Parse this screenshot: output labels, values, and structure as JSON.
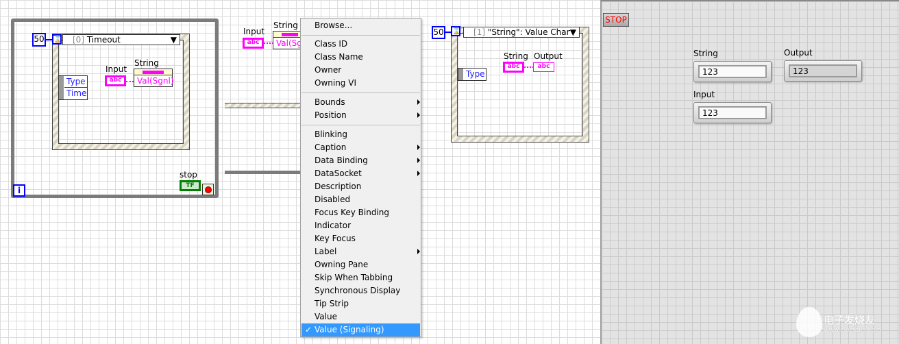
{
  "block_diagram": {
    "loop": {
      "iteration_terminal": "i",
      "stop_label": "stop",
      "stop_terminal": "TF"
    },
    "event_structure_0": {
      "timeout_value": "50",
      "selector": "Timeout",
      "selector_index": "[0]",
      "event_data": [
        "Type",
        "Time"
      ],
      "input_label": "Input",
      "input_terminal": "abc",
      "property_node_label": "String",
      "property": "Val(Sgnl)"
    },
    "partial_node": {
      "input_label": "Input",
      "input_terminal": "abc",
      "property_node_label": "String",
      "property": "Val(Sg"
    },
    "event_structure_1": {
      "timeout_value": "50",
      "selector": "\"String\": Value Chang",
      "selector_index": "[1]",
      "event_data": [
        "Type"
      ],
      "string_label": "String",
      "output_label": "Output",
      "terminal": "abc"
    }
  },
  "context_menu": {
    "groups": [
      [
        "Browse..."
      ],
      [
        "Class ID",
        "Class Name",
        "Owner",
        "Owning VI"
      ],
      [
        {
          "label": "Bounds",
          "submenu": true
        },
        {
          "label": "Position",
          "submenu": true
        }
      ],
      [
        {
          "label": "Blinking"
        },
        {
          "label": "Caption",
          "submenu": true
        },
        {
          "label": "Data Binding",
          "submenu": true
        },
        {
          "label": "DataSocket",
          "submenu": true
        },
        {
          "label": "Description"
        },
        {
          "label": "Disabled"
        },
        {
          "label": "Focus Key Binding"
        },
        {
          "label": "Indicator"
        },
        {
          "label": "Key Focus"
        },
        {
          "label": "Label",
          "submenu": true
        },
        {
          "label": "Owning Pane"
        },
        {
          "label": "Skip When Tabbing"
        },
        {
          "label": "Synchronous Display"
        },
        {
          "label": "Tip Strip"
        },
        {
          "label": "Value"
        },
        {
          "label": "Value (Signaling)",
          "checked": true,
          "highlighted": true
        }
      ]
    ],
    "check_mark": "✓"
  },
  "front_panel": {
    "stop_button": "STOP",
    "string": {
      "label": "String",
      "value": "123"
    },
    "output": {
      "label": "Output",
      "value": "123"
    },
    "input": {
      "label": "Input",
      "value": "123"
    }
  },
  "watermark": {
    "text": "电子发烧友",
    "url": "www.elecfans.com"
  },
  "colors": {
    "string_wire": "#ff00ff",
    "numeric": "#0000ff",
    "boolean": "#008000",
    "highlight": "#3399ff"
  }
}
